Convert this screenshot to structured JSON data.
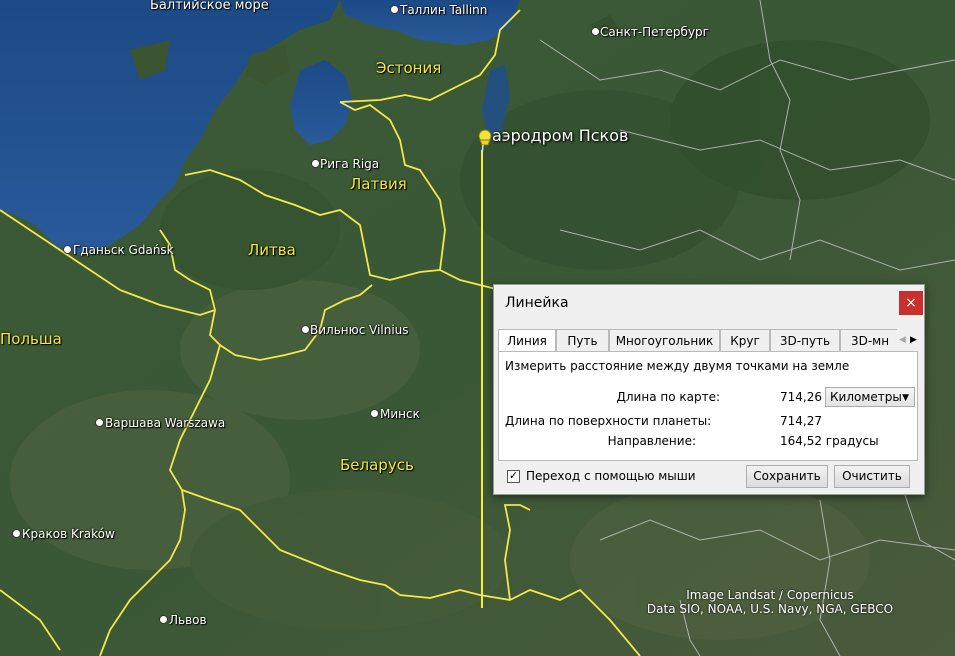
{
  "map": {
    "sea_label": "Балтийское море",
    "place_marker": {
      "label": "аэродром Псков",
      "icon": "pushpin-icon"
    },
    "cities": [
      {
        "key": "tallinn",
        "name": "Таллин Tallinn"
      },
      {
        "key": "spb",
        "name": "Санкт-Петербург"
      },
      {
        "key": "riga",
        "name": "Рига Riga"
      },
      {
        "key": "gdansk",
        "name": "Гданьск Gdańsk"
      },
      {
        "key": "vilnius",
        "name": "Вильнюс Vilnius"
      },
      {
        "key": "minsk",
        "name": "Минск"
      },
      {
        "key": "warsaw",
        "name": "Варшава Warszawa"
      },
      {
        "key": "krakow",
        "name": "Краков Kraków"
      },
      {
        "key": "lviv",
        "name": "Львов"
      }
    ],
    "countries": [
      {
        "key": "estonia",
        "name": "Эстония"
      },
      {
        "key": "latvia",
        "name": "Латвия"
      },
      {
        "key": "lithuania",
        "name": "Литва"
      },
      {
        "key": "poland",
        "name": "Польша"
      },
      {
        "key": "belarus",
        "name": "Беларусь"
      }
    ],
    "credits": [
      "Image Landsat / Copernicus",
      "Data SIO, NOAA, U.S. Navy, NGA, GEBCO"
    ],
    "colors": {
      "border": "#f2e84a",
      "water": "#1f4f8c",
      "ruler_line": "#f5ee3a"
    }
  },
  "ruler": {
    "title": "Линейка",
    "close_label": "×",
    "tabs": [
      "Линия",
      "Путь",
      "Многоугольник",
      "Круг",
      "3D-путь",
      "3D-мн"
    ],
    "active_tab": "Линия",
    "description": "Измерить расстояние между двумя точками на земле",
    "map_length_label": "Длина по карте:",
    "map_length_value": "714,26",
    "unit_select": "Километры",
    "ground_length_label": "Длина по поверхности планеты:",
    "ground_length_value": "714,27",
    "heading_label": "Направление:",
    "heading_value": "164,52 градусы",
    "mouse_nav_label": "Переход с помощью мыши",
    "mouse_nav_checked": true,
    "save_label": "Сохранить",
    "clear_label": "Очистить"
  }
}
